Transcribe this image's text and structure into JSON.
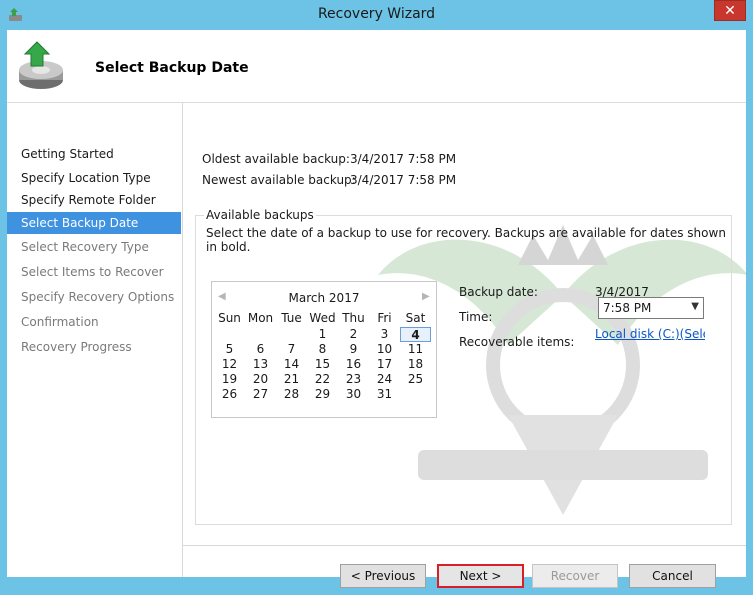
{
  "window": {
    "title": "Recovery Wizard",
    "close_glyph": "✕"
  },
  "header": {
    "title": "Select Backup Date",
    "icon": "backup-recovery-icon"
  },
  "nav": {
    "items": [
      {
        "label": "Getting Started",
        "state": "done"
      },
      {
        "label": "Specify Location Type",
        "state": "done"
      },
      {
        "label": "Specify Remote Folder",
        "state": "done"
      },
      {
        "label": "Select Backup Date",
        "state": "active"
      },
      {
        "label": "Select Recovery Type",
        "state": "future"
      },
      {
        "label": "Select Items to Recover",
        "state": "future"
      },
      {
        "label": "Specify Recovery Options",
        "state": "future"
      },
      {
        "label": "Confirmation",
        "state": "future"
      },
      {
        "label": "Recovery Progress",
        "state": "future"
      }
    ]
  },
  "info": {
    "oldest_label": "Oldest available backup:",
    "oldest_value": "3/4/2017 7:58 PM",
    "newest_label": "Newest available backup:",
    "newest_value": "3/4/2017 7:58 PM"
  },
  "available": {
    "title": "Available backups",
    "description": "Select the date of a backup to use for recovery. Backups are available for dates shown in bold."
  },
  "calendar": {
    "month": "March 2017",
    "prev_glyph": "◀",
    "next_glyph": "▶",
    "weekdays": [
      "Sun",
      "Mon",
      "Tue",
      "Wed",
      "Thu",
      "Fri",
      "Sat"
    ],
    "weeks": [
      [
        "",
        "",
        "",
        "1",
        "2",
        "3",
        "4"
      ],
      [
        "5",
        "6",
        "7",
        "8",
        "9",
        "10",
        "11"
      ],
      [
        "12",
        "13",
        "14",
        "15",
        "16",
        "17",
        "18"
      ],
      [
        "19",
        "20",
        "21",
        "22",
        "23",
        "24",
        "25"
      ],
      [
        "26",
        "27",
        "28",
        "29",
        "30",
        "31",
        ""
      ]
    ],
    "bold_day": "4",
    "selected_day": "4"
  },
  "details": {
    "backup_date_label": "Backup date:",
    "backup_date_value": "3/4/2017",
    "time_label": "Time:",
    "time_value": "7:58 PM",
    "time_arrow": "▼",
    "items_label": "Recoverable items:",
    "items_link": "Local disk (C:)(Sele..."
  },
  "buttons": {
    "previous": "< Previous",
    "next": "Next >",
    "recover": "Recover",
    "cancel": "Cancel"
  },
  "colors": {
    "frame": "#6cc3e6",
    "nav_active": "#3f92df",
    "close": "#c8372d",
    "link": "#0b57c9",
    "highlight_border": "#d9202a"
  }
}
